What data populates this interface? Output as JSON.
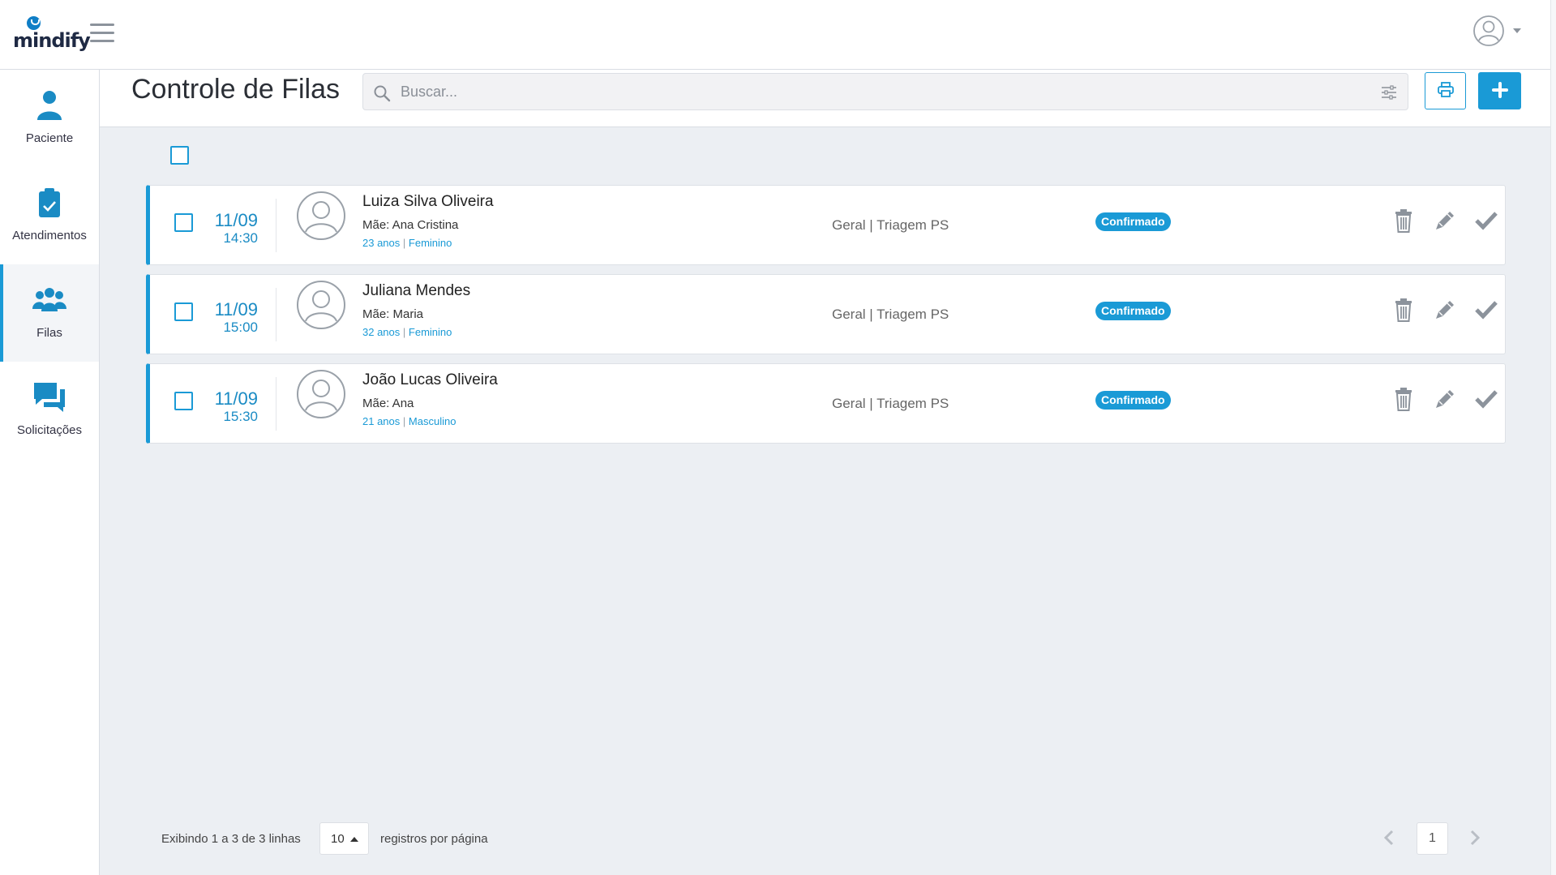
{
  "app": {
    "logo_text": "mindify"
  },
  "sidebar": {
    "items": [
      {
        "label": "Paciente",
        "icon": "person-icon",
        "active": false
      },
      {
        "label": "Atendimentos",
        "icon": "clipboard-check-icon",
        "active": false
      },
      {
        "label": "Filas",
        "icon": "users-group-icon",
        "active": true
      },
      {
        "label": "Solicitações",
        "icon": "chat-bubbles-icon",
        "active": false
      }
    ]
  },
  "header": {
    "title": "Controle de Filas",
    "search_placeholder": "Buscar..."
  },
  "rows": [
    {
      "date": "11/09",
      "time": "14:30",
      "name": "Luiza Silva Oliveira",
      "mother": "Mãe: Ana Cristina",
      "age": "23 anos",
      "sex": "Feminino",
      "sector": "Geral | Triagem PS",
      "status": "Confirmado"
    },
    {
      "date": "11/09",
      "time": "15:00",
      "name": "Juliana Mendes",
      "mother": "Mãe: Maria",
      "age": "32 anos",
      "sex": "Feminino",
      "sector": "Geral | Triagem PS",
      "status": "Confirmado"
    },
    {
      "date": "11/09",
      "time": "15:30",
      "name": "João Lucas Oliveira",
      "mother": "Mãe: Ana",
      "age": "21 anos",
      "sex": "Masculino",
      "sector": "Geral | Triagem PS",
      "status": "Confirmado"
    }
  ],
  "footer": {
    "info": "Exibindo 1 a 3 de 3 linhas",
    "page_size": "10",
    "suffix": "registros por página",
    "current_page": "1"
  },
  "colors": {
    "accent": "#1a9ad6",
    "background": "#eceff3",
    "badge": "#1a9ad6"
  }
}
